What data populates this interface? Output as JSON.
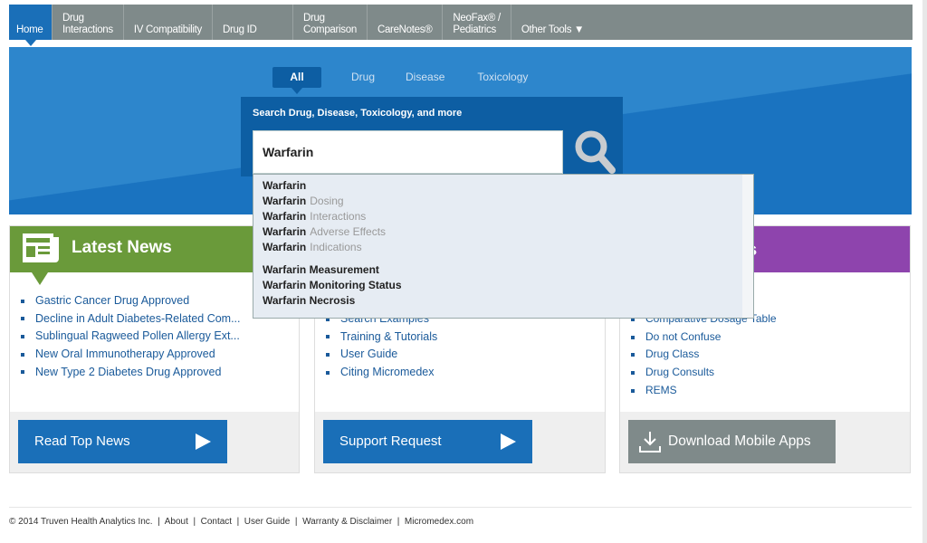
{
  "nav": {
    "tabs": [
      {
        "l1": "",
        "l2": "Home"
      },
      {
        "l1": "Drug",
        "l2": "Interactions"
      },
      {
        "l1": "",
        "l2": "IV Compatibility"
      },
      {
        "l1": "",
        "l2": "Drug ID"
      },
      {
        "l1": "Drug",
        "l2": "Comparison"
      },
      {
        "l1": "",
        "l2": "CareNotes®"
      },
      {
        "l1": "NeoFax® /",
        "l2": "Pediatrics"
      },
      {
        "l1": "",
        "l2": "Other Tools ▼"
      }
    ]
  },
  "search": {
    "tabs": [
      "All",
      "Drug",
      "Disease",
      "Toxicology"
    ],
    "label": "Search Drug, Disease, Toxicology, and more",
    "value": "Warfarin",
    "suggestions": [
      {
        "b": "Warfarin",
        "s": ""
      },
      {
        "b": "Warfarin",
        "s": "Dosing"
      },
      {
        "b": "Warfarin",
        "s": "Interactions"
      },
      {
        "b": "Warfarin",
        "s": "Adverse Effects"
      },
      {
        "b": "Warfarin",
        "s": "Indications"
      }
    ],
    "more": [
      "Warfarin Measurement",
      "Warfarin Monitoring Status",
      "Warfarin Necrosis"
    ]
  },
  "news": {
    "title": "Latest News",
    "color": "#6a9a3a",
    "items": [
      "Gastric Cancer Drug Approved",
      "Decline in Adult Diabetes-Related Com...",
      "Sublingual Ragweed Pollen Allergy Ext...",
      "New Oral Immunotherapy Approved",
      "New Type 2 Diabetes Drug Approved"
    ],
    "button": "Read Top News"
  },
  "support": {
    "items": [
      "Search Examples",
      "Training & Tutorials",
      "User Guide",
      "Citing Micromedex"
    ],
    "button": "Support Request"
  },
  "resources": {
    "title_visible": "es",
    "color": "#8e44ad",
    "items": [
      "Comparative Dosage Table",
      "Do not Confuse",
      "Drug Class",
      "Drug Consults",
      "REMS"
    ],
    "button": "Download Mobile Apps"
  },
  "footer": {
    "copyright": "© 2014 Truven Health Analytics Inc.",
    "links": [
      "About",
      "Contact",
      "User Guide",
      "Warranty & Disclaimer",
      "Micromedex.com"
    ]
  }
}
